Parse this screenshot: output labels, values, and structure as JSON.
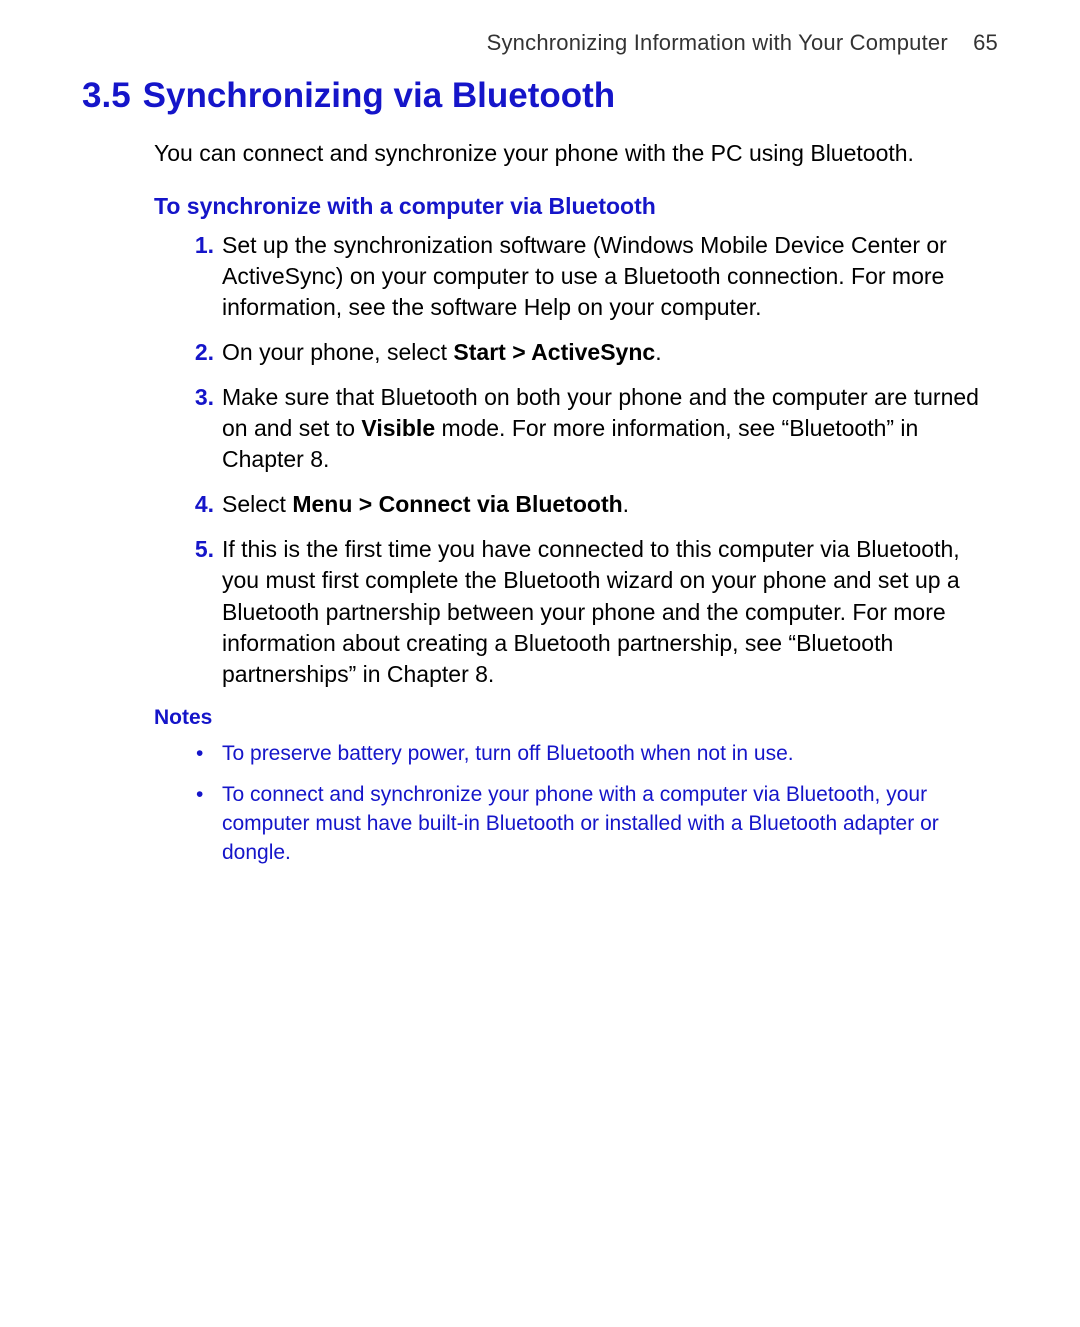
{
  "header": {
    "running_title": "Synchronizing Information with Your Computer",
    "page_number": "65"
  },
  "section": {
    "number": "3.5",
    "title": "Synchronizing via Bluetooth",
    "intro": "You can connect and synchronize your phone with the PC using Bluetooth.",
    "sub_title": "To synchronize with a computer via Bluetooth",
    "steps": [
      {
        "num": "1.",
        "parts": [
          {
            "text": "Set up the synchronization software (Windows Mobile Device Center or ActiveSync) on your computer to use a Bluetooth connection. For more information, see the software Help on your computer.",
            "bold": false
          }
        ]
      },
      {
        "num": "2.",
        "parts": [
          {
            "text": "On your phone, select ",
            "bold": false
          },
          {
            "text": "Start > ActiveSync",
            "bold": true
          },
          {
            "text": ".",
            "bold": false
          }
        ]
      },
      {
        "num": "3.",
        "parts": [
          {
            "text": "Make sure that Bluetooth on both your phone and the computer are turned on and set to ",
            "bold": false
          },
          {
            "text": "Visible",
            "bold": true
          },
          {
            "text": " mode. For more information, see “Bluetooth” in Chapter 8.",
            "bold": false
          }
        ]
      },
      {
        "num": "4.",
        "parts": [
          {
            "text": "Select ",
            "bold": false
          },
          {
            "text": "Menu > Connect via Bluetooth",
            "bold": true
          },
          {
            "text": ".",
            "bold": false
          }
        ]
      },
      {
        "num": "5.",
        "parts": [
          {
            "text": "If this is the first time you have connected to this computer via Bluetooth, you must first complete the Bluetooth wizard on your phone and set up a Bluetooth partnership between your phone and the computer. For more information about creating a Bluetooth partnership, see “Bluetooth partnerships” in Chapter 8.",
            "bold": false
          }
        ]
      }
    ],
    "notes_heading": "Notes",
    "notes": [
      "To preserve battery power, turn off Bluetooth when not in use.",
      "To connect and synchronize your phone with a computer via Bluetooth, your computer must have built-in Bluetooth or installed with a Bluetooth adapter or dongle."
    ]
  }
}
